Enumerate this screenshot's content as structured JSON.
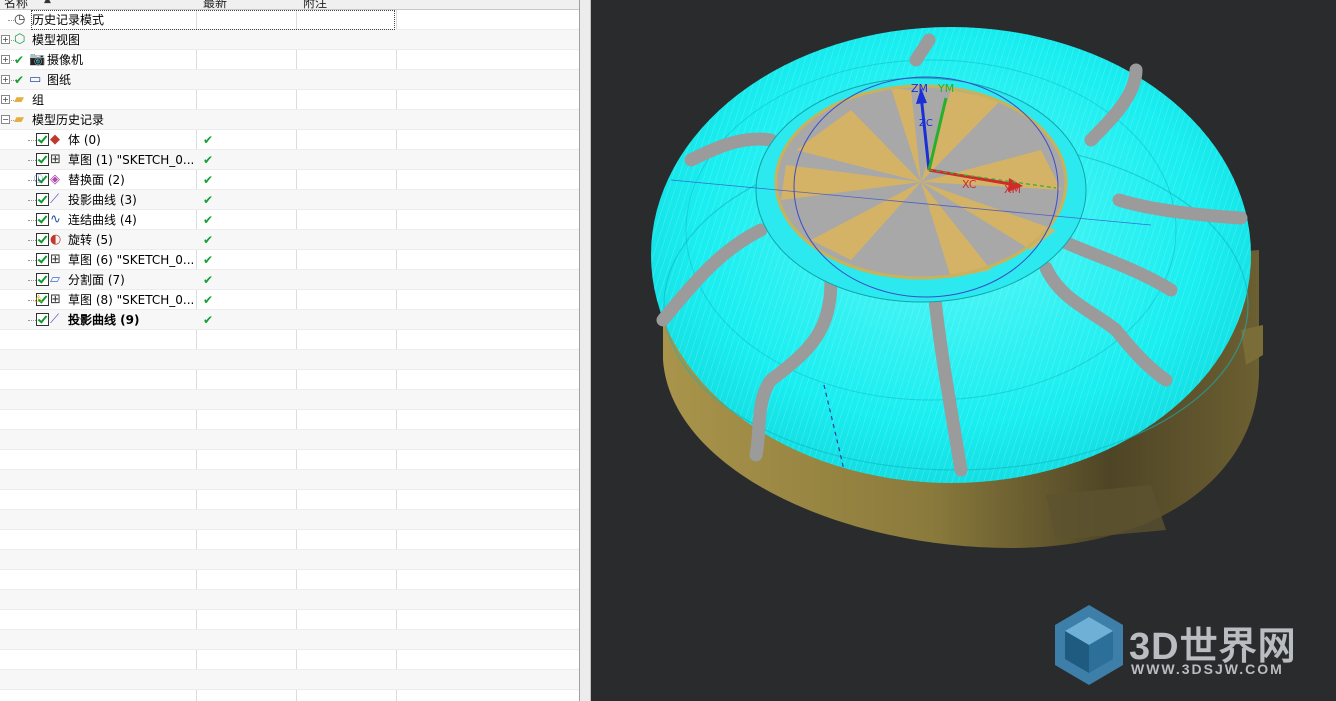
{
  "navigator": {
    "columns": [
      "名称",
      "最新",
      "附注"
    ],
    "rows": [
      {
        "label": "历史记录模式",
        "icon": "clock-icon",
        "indent": 1,
        "expander": "",
        "visible_check": false,
        "model_check": false,
        "latest": false,
        "bold": false,
        "selected": true
      },
      {
        "label": "模型视图",
        "icon": "model-views-icon",
        "indent": 1,
        "expander": "+",
        "visible_check": false,
        "model_check": false,
        "latest": false,
        "bold": false
      },
      {
        "label": "摄像机",
        "icon": "camera-icon",
        "indent": 1,
        "expander": "+",
        "visible_check": true,
        "model_check": false,
        "latest": false,
        "bold": false
      },
      {
        "label": "图纸",
        "icon": "drawing-icon",
        "indent": 1,
        "expander": "+",
        "visible_check": true,
        "model_check": false,
        "latest": false,
        "bold": false
      },
      {
        "label": "组",
        "icon": "folder-icon",
        "indent": 1,
        "expander": "+",
        "visible_check": false,
        "model_check": false,
        "latest": false,
        "bold": false
      },
      {
        "label": "模型历史记录",
        "icon": "folder-open-icon",
        "indent": 1,
        "expander": "-",
        "visible_check": false,
        "model_check": false,
        "latest": false,
        "bold": false
      },
      {
        "label": "体 (0)",
        "icon": "body-icon",
        "indent": 2,
        "expander": "",
        "visible_check": false,
        "model_check": true,
        "latest": true,
        "bold": false
      },
      {
        "label": "草图 (1) \"SKETCH_0...",
        "icon": "sketch-icon",
        "indent": 2,
        "expander": "",
        "visible_check": false,
        "model_check": true,
        "latest": true,
        "bold": false
      },
      {
        "label": "替换面 (2)",
        "icon": "replace-face-icon",
        "indent": 2,
        "expander": "",
        "visible_check": false,
        "model_check": true,
        "latest": true,
        "bold": false,
        "info": true
      },
      {
        "label": "投影曲线 (3)",
        "icon": "project-curve-icon",
        "indent": 2,
        "expander": "",
        "visible_check": false,
        "model_check": true,
        "latest": true,
        "bold": false
      },
      {
        "label": "连结曲线 (4)",
        "icon": "join-curve-icon",
        "indent": 2,
        "expander": "",
        "visible_check": false,
        "model_check": true,
        "latest": true,
        "bold": false
      },
      {
        "label": "旋转 (5)",
        "icon": "revolve-icon",
        "indent": 2,
        "expander": "",
        "visible_check": false,
        "model_check": true,
        "latest": true,
        "bold": false
      },
      {
        "label": "草图 (6) \"SKETCH_0...",
        "icon": "sketch-icon",
        "indent": 2,
        "expander": "",
        "visible_check": false,
        "model_check": true,
        "latest": true,
        "bold": false
      },
      {
        "label": "分割面 (7)",
        "icon": "divide-face-icon",
        "indent": 2,
        "expander": "",
        "visible_check": false,
        "model_check": true,
        "latest": true,
        "bold": false
      },
      {
        "label": "草图 (8) \"SKETCH_0...",
        "icon": "sketch-icon",
        "indent": 2,
        "expander": "",
        "visible_check": false,
        "model_check": true,
        "latest": true,
        "bold": false,
        "warn": true
      },
      {
        "label": "投影曲线 (9)",
        "icon": "project-curve-icon",
        "indent": 2,
        "expander": "",
        "visible_check": false,
        "model_check": true,
        "latest": true,
        "bold": true
      }
    ],
    "empty_rows": 18
  },
  "viewport": {
    "axes": {
      "zm": "ZM",
      "ym": "YM",
      "zc": "ZC",
      "xc": "XC",
      "xm": "XM"
    },
    "colors": {
      "background": "#2a2b2d",
      "cyan_surface": "#19f0f0",
      "gold_body": "#c9b25a",
      "groove_gray": "#9a9a9a"
    }
  },
  "watermark": {
    "title": "3D世界网",
    "subtitle": "WWW.3DSJW.COM"
  }
}
